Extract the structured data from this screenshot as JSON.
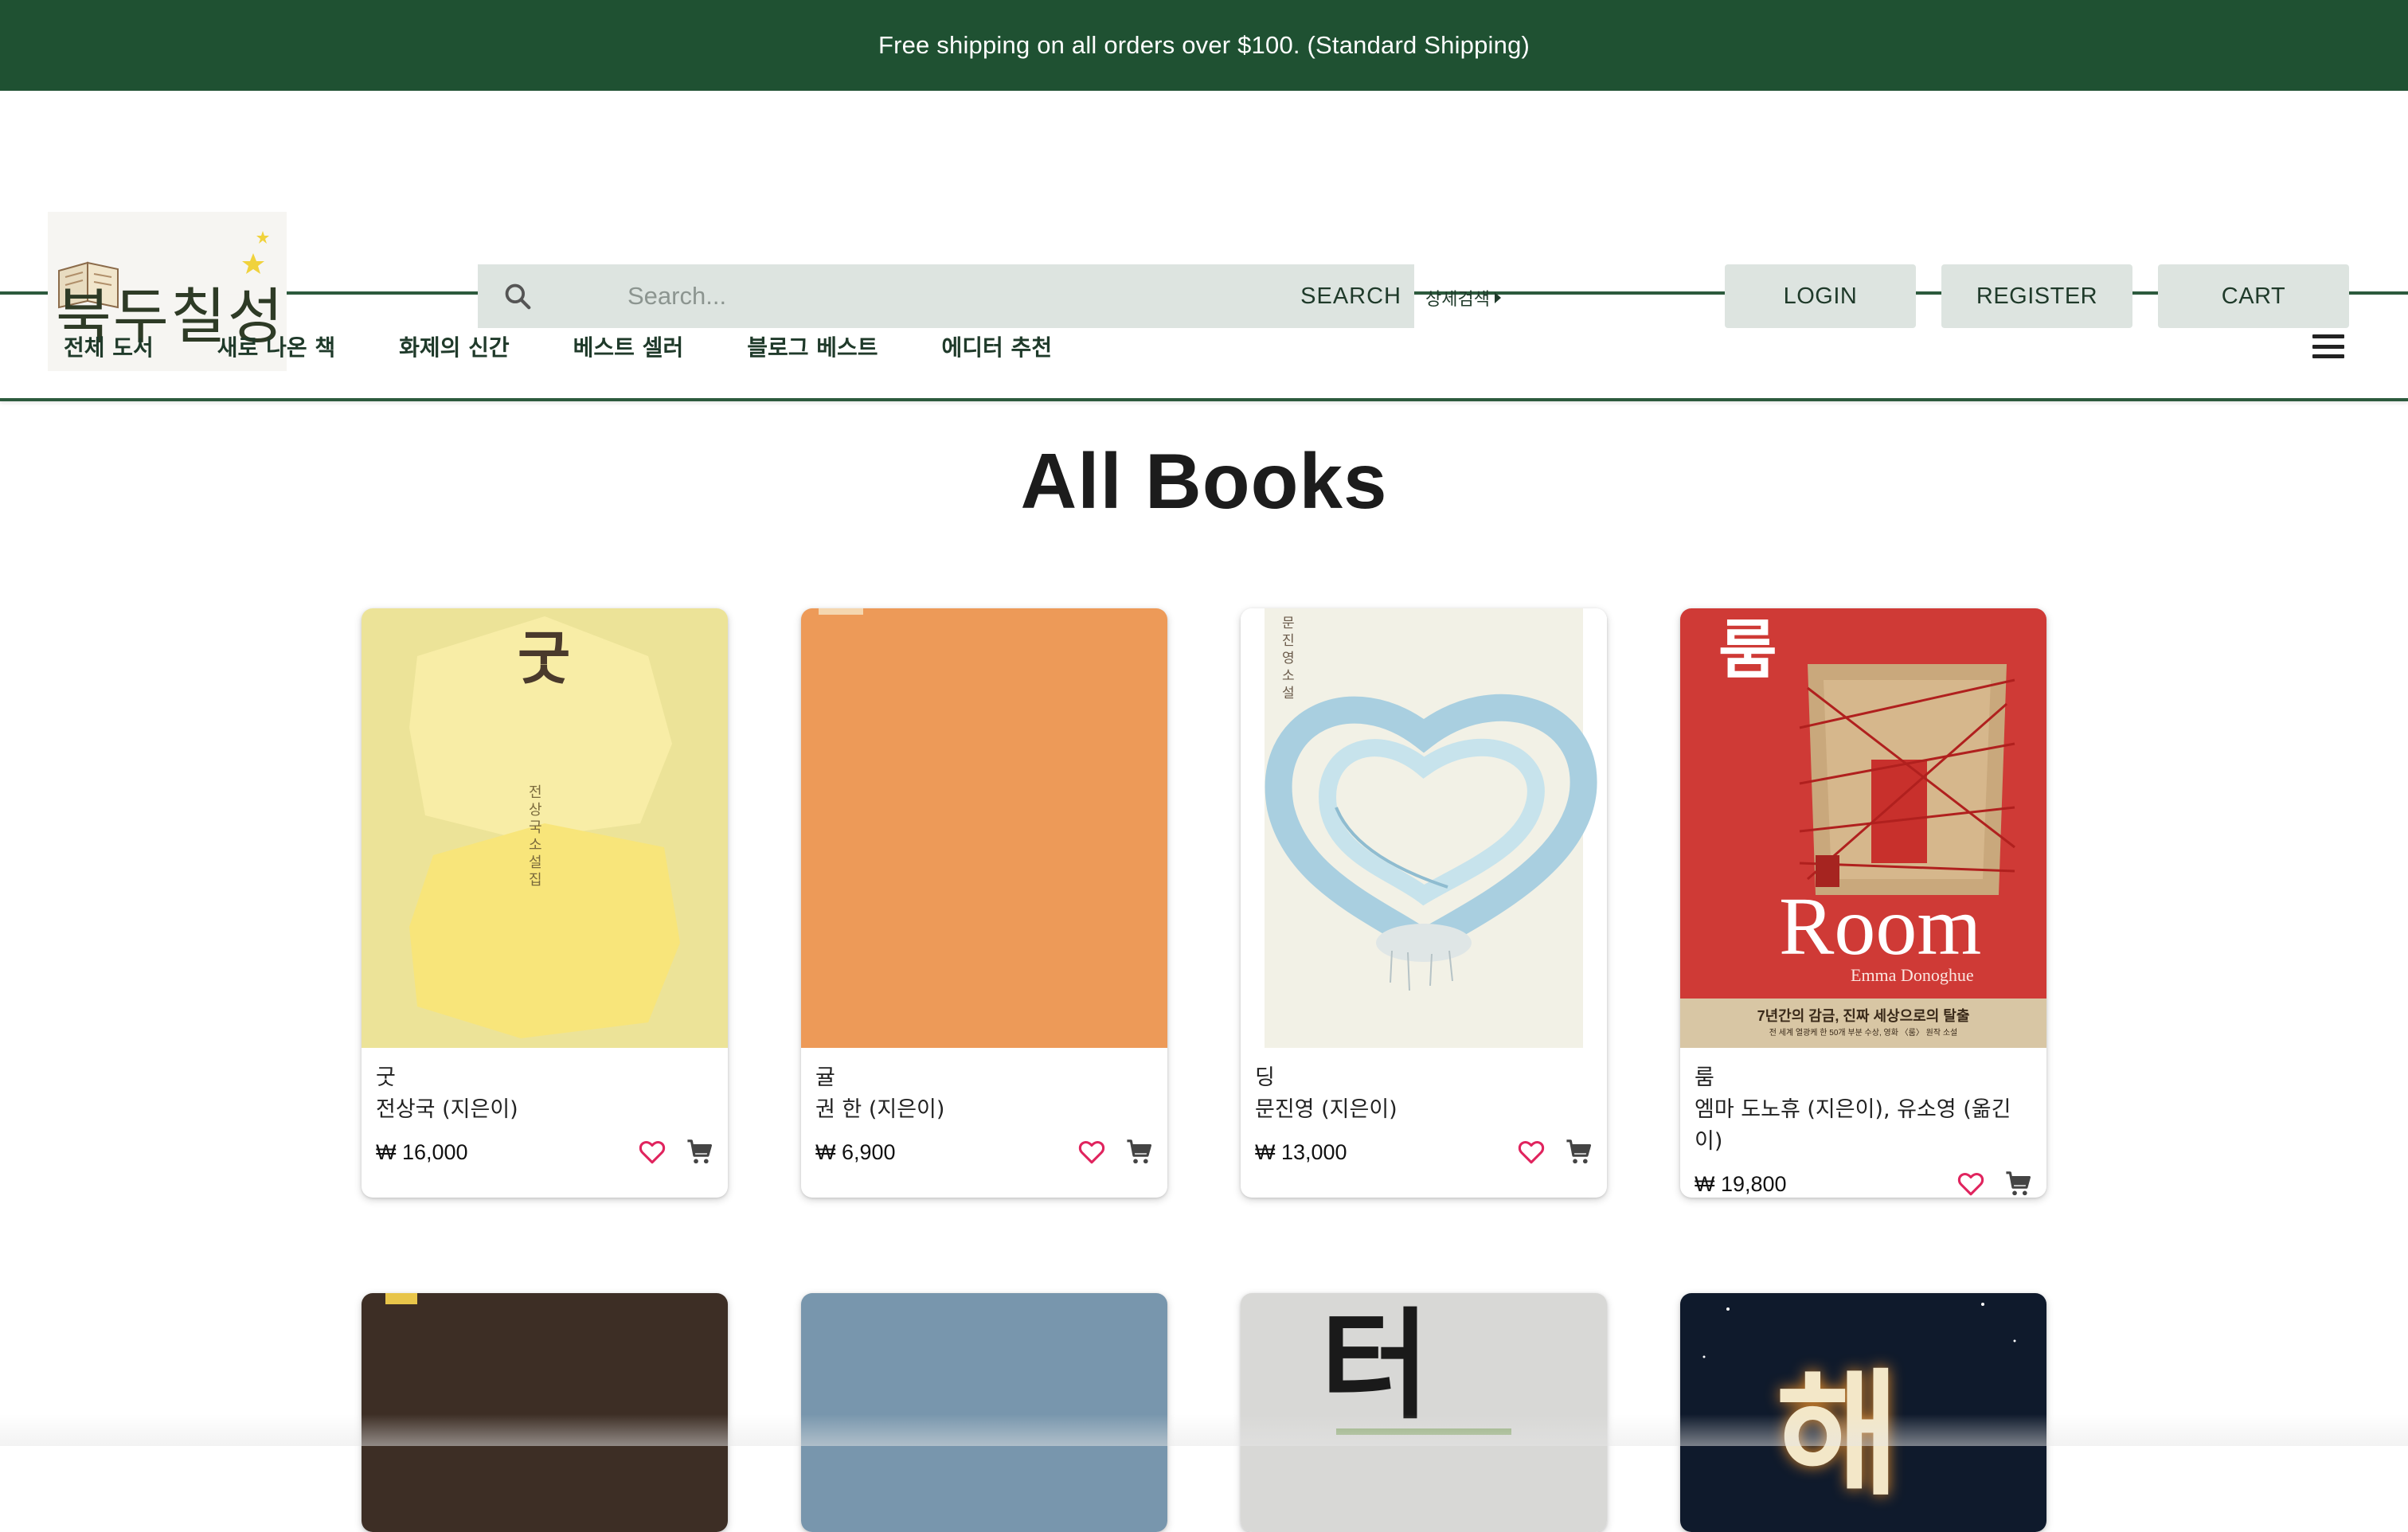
{
  "promo": {
    "text": "Free shipping on all orders over $100. (Standard Shipping)"
  },
  "header": {
    "logo_text": "북두칠성",
    "search": {
      "placeholder": "Search...",
      "button_label": "SEARCH",
      "advanced_label": "상세검색"
    },
    "buttons": {
      "login": "LOGIN",
      "register": "REGISTER",
      "cart": "CART"
    }
  },
  "nav": {
    "items": [
      "전체 도서",
      "새로 나온 책",
      "화제의 신간",
      "베스트 셀러",
      "블로그 베스트",
      "에디터 추천"
    ]
  },
  "page": {
    "title": "All Books"
  },
  "books": [
    {
      "title": "굿",
      "author": "전상국 (지은이)",
      "price": "₩ 16,000",
      "cover_text": "굿",
      "cover_subtext": "전상국 소설집"
    },
    {
      "title": "귤",
      "author": "권 한 (지은이)",
      "price": "₩ 6,900"
    },
    {
      "title": "딩",
      "author": "문진영 (지은이)",
      "price": "₩ 13,000",
      "cover_text": "문진영 소설"
    },
    {
      "title": "룸",
      "author": "엠마 도노휴 (지은이), 유소영 (옮긴이)",
      "price": "₩ 19,800",
      "cover_text": "룸",
      "cover_title": "Room",
      "cover_author": "Emma Donoghue",
      "cover_tagline": "7년간의 감금, 진짜 세상으로의 탈출",
      "cover_small": "전 세계 열광케 한 50개 부분 수상, 영화 〈룸〉 원작 소설"
    }
  ],
  "books_row2": [
    {
      "cover_color": "#3d2e25"
    },
    {
      "cover_color": "#7896ad"
    },
    {
      "cover_text": "터"
    },
    {
      "cover_text": "해"
    }
  ],
  "colors": {
    "brand_green": "#1f5132",
    "button_bg": "#dde4e0",
    "heart": "#e0245e",
    "cover_gut": "#ece398",
    "cover_gyul": "#ed9a58",
    "cover_ding": "#f2f1e6",
    "cover_room": "#cf3a36"
  },
  "icons": {
    "search": "search-icon",
    "heart": "heart-outline-icon",
    "cart": "cart-icon",
    "menu": "hamburger-menu-icon"
  }
}
